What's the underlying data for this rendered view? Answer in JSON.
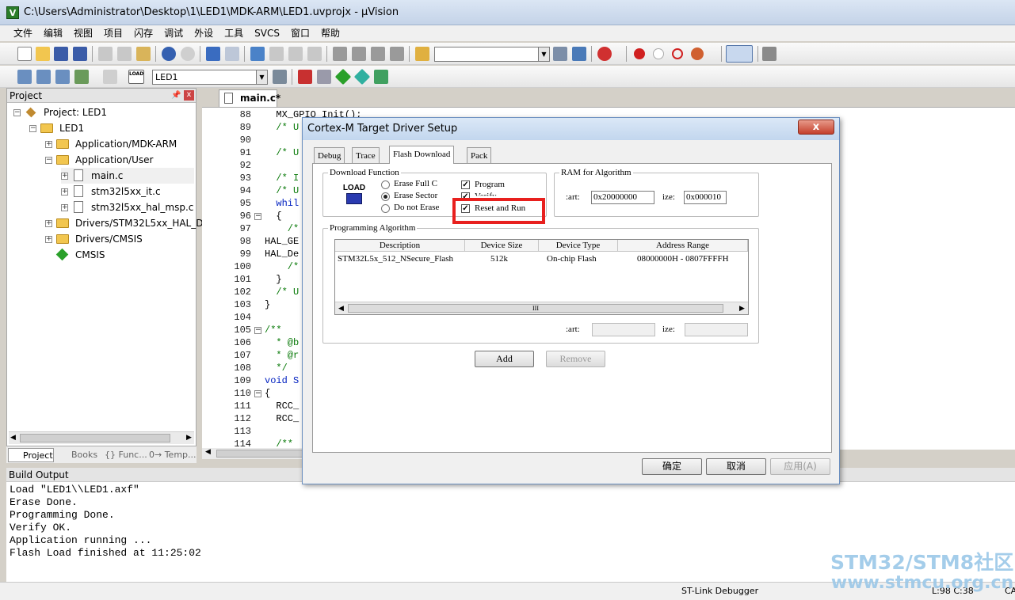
{
  "window": {
    "title": "C:\\Users\\Administrator\\Desktop\\1\\LED1\\MDK-ARM\\LED1.uvprojx - µVision",
    "app_icon": "V"
  },
  "menu": [
    "文件",
    "编辑",
    "视图",
    "项目",
    "闪存",
    "调试",
    "外设",
    "工具",
    "SVCS",
    "窗口",
    "帮助"
  ],
  "toolbar2": {
    "target": "LED1",
    "load_label": "LOAD"
  },
  "project": {
    "header": "Project",
    "tree": [
      {
        "label": "Project: LED1"
      },
      {
        "label": "LED1"
      },
      {
        "label": "Application/MDK-ARM"
      },
      {
        "label": "Application/User"
      },
      {
        "label": "main.c"
      },
      {
        "label": "stm32l5xx_it.c"
      },
      {
        "label": "stm32l5xx_hal_msp.c"
      },
      {
        "label": "Drivers/STM32L5xx_HAL_Driv"
      },
      {
        "label": "Drivers/CMSIS"
      },
      {
        "label": "CMSIS"
      }
    ],
    "tabs": [
      "Project",
      "Books",
      "{} Func...",
      "0→ Temp..."
    ]
  },
  "editor": {
    "tab": "main.c*",
    "lines": [
      {
        "n": "88",
        "t": "  MX_GPIO_Init();"
      },
      {
        "n": "89",
        "t": "  /* U"
      },
      {
        "n": "90",
        "t": ""
      },
      {
        "n": "91",
        "t": "  /* U"
      },
      {
        "n": "92",
        "t": ""
      },
      {
        "n": "93",
        "t": "  /* I"
      },
      {
        "n": "94",
        "t": "  /* U"
      },
      {
        "n": "95",
        "t": "  whil"
      },
      {
        "n": "96",
        "t": "  {"
      },
      {
        "n": "97",
        "t": "    /*"
      },
      {
        "n": "98",
        "t": "HAL_GE"
      },
      {
        "n": "99",
        "t": "HAL_De"
      },
      {
        "n": "100",
        "t": "    /*"
      },
      {
        "n": "101",
        "t": "  }"
      },
      {
        "n": "102",
        "t": "  /* U"
      },
      {
        "n": "103",
        "t": "}"
      },
      {
        "n": "104",
        "t": ""
      },
      {
        "n": "105",
        "t": "/**"
      },
      {
        "n": "106",
        "t": "  * @b"
      },
      {
        "n": "107",
        "t": "  * @r"
      },
      {
        "n": "108",
        "t": "  */"
      },
      {
        "n": "109",
        "t": "void S"
      },
      {
        "n": "110",
        "t": "{"
      },
      {
        "n": "111",
        "t": "  RCC_"
      },
      {
        "n": "112",
        "t": "  RCC_"
      },
      {
        "n": "113",
        "t": ""
      },
      {
        "n": "114",
        "t": "  /**"
      }
    ]
  },
  "build": {
    "header": "Build Output",
    "lines": [
      "Load \"LED1\\\\LED1.axf\"",
      "Erase Done.",
      "Programming Done.",
      "Verify OK.",
      "Application running ...",
      "Flash Load finished at 11:25:02"
    ]
  },
  "status": {
    "debugger": "ST-Link Debugger",
    "position": "L:98 C:38",
    "extra": "CA"
  },
  "dialog": {
    "title": "Cortex-M Target Driver Setup",
    "close": "x",
    "tabs": [
      "Debug",
      "Trace",
      "Flash Download",
      "Pack"
    ],
    "download_function": {
      "title": "Download Function",
      "load_icon": "LOAD",
      "radios": [
        {
          "label": "Erase Full C",
          "checked": false
        },
        {
          "label": "Erase Sector",
          "checked": true
        },
        {
          "label": "Do not Erase",
          "checked": false
        }
      ],
      "checks": [
        {
          "label": "Program",
          "checked": true
        },
        {
          "label": "Verify",
          "checked": true
        },
        {
          "label": "Reset and Run",
          "checked": true
        }
      ]
    },
    "ram": {
      "title": "RAM for Algorithm",
      "start_label": ":art:",
      "start": "0x20000000",
      "size_label": "ize:",
      "size": "0x000010"
    },
    "algo": {
      "title": "Programming Algorithm",
      "headers": [
        "Description",
        "Device Size",
        "Device Type",
        "Address Range"
      ],
      "rows": [
        {
          "desc": "STM32L5x_512_NSecure_Flash",
          "size": "512k",
          "type": "On-chip Flash",
          "range": "08000000H - 0807FFFFH"
        }
      ],
      "start_label": ":art:",
      "size_label": "ize:",
      "scroll_grip": "III"
    },
    "buttons": {
      "add": "Add",
      "remove": "Remove",
      "ok": "确定",
      "cancel": "取消",
      "apply": "应用(A)"
    }
  },
  "watermark": {
    "line1": "STM32/STM8社区",
    "line2": "www.stmcu.org.cn"
  }
}
